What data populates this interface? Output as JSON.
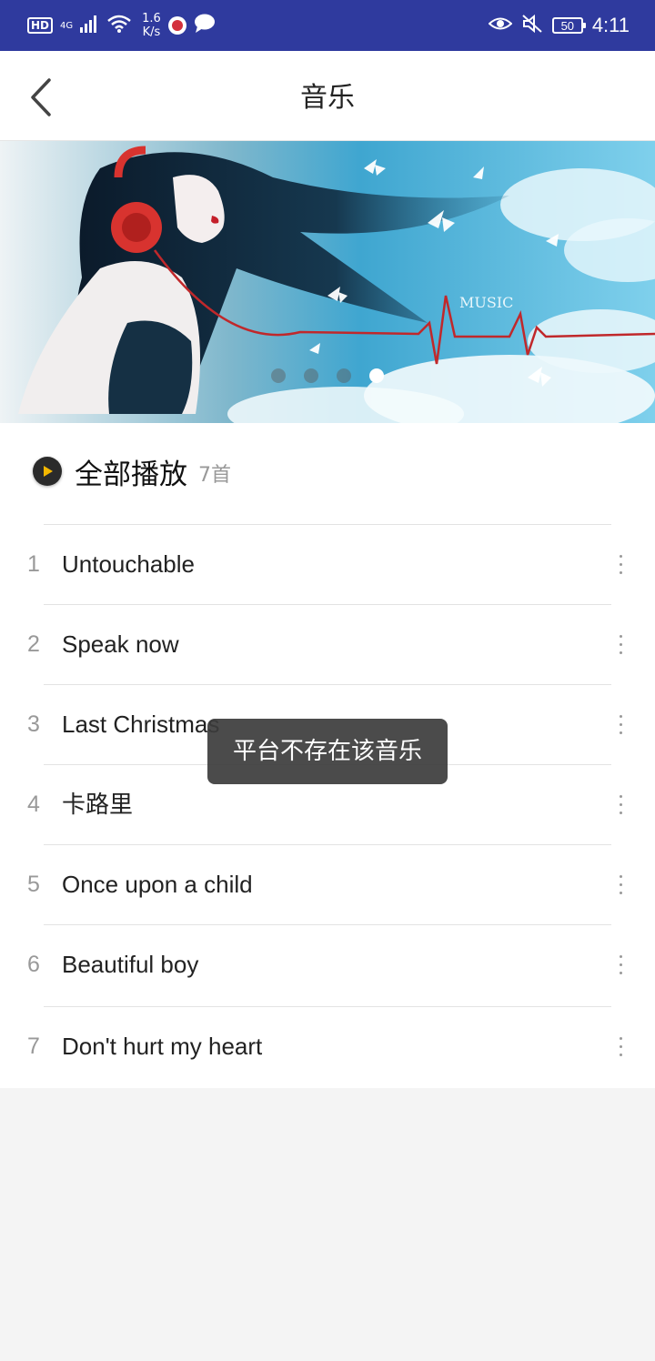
{
  "status_bar": {
    "hd": "HD",
    "network": "4G",
    "speed_value": "1.6",
    "speed_unit": "K/s",
    "battery": "50",
    "time": "4:11",
    "icons": [
      "hd-icon",
      "signal-icon",
      "wifi-icon",
      "app-notification-icon",
      "message-icon",
      "eye-icon",
      "mute-icon",
      "battery-icon"
    ]
  },
  "header": {
    "back_icon": "chevron-left-icon",
    "title": "音乐"
  },
  "banner": {
    "active_index": 3,
    "dot_count": 4,
    "text": "MUSIC"
  },
  "play_all": {
    "label": "全部播放",
    "count": "7首",
    "icon": "play-icon"
  },
  "tracks": [
    {
      "number": "1",
      "title": "Untouchable"
    },
    {
      "number": "2",
      "title": "Speak now"
    },
    {
      "number": "3",
      "title": "Last Christmas"
    },
    {
      "number": "4",
      "title": "卡路里"
    },
    {
      "number": "5",
      "title": "Once upon a child"
    },
    {
      "number": "6",
      "title": "Beautiful boy"
    },
    {
      "number": "7",
      "title": "Don't hurt my heart"
    }
  ],
  "toast": {
    "message": "平台不存在该音乐"
  },
  "colors": {
    "status_bar": "#2f3a9e",
    "play_accent": "#f5b800",
    "heartbeat": "#c0282b"
  }
}
